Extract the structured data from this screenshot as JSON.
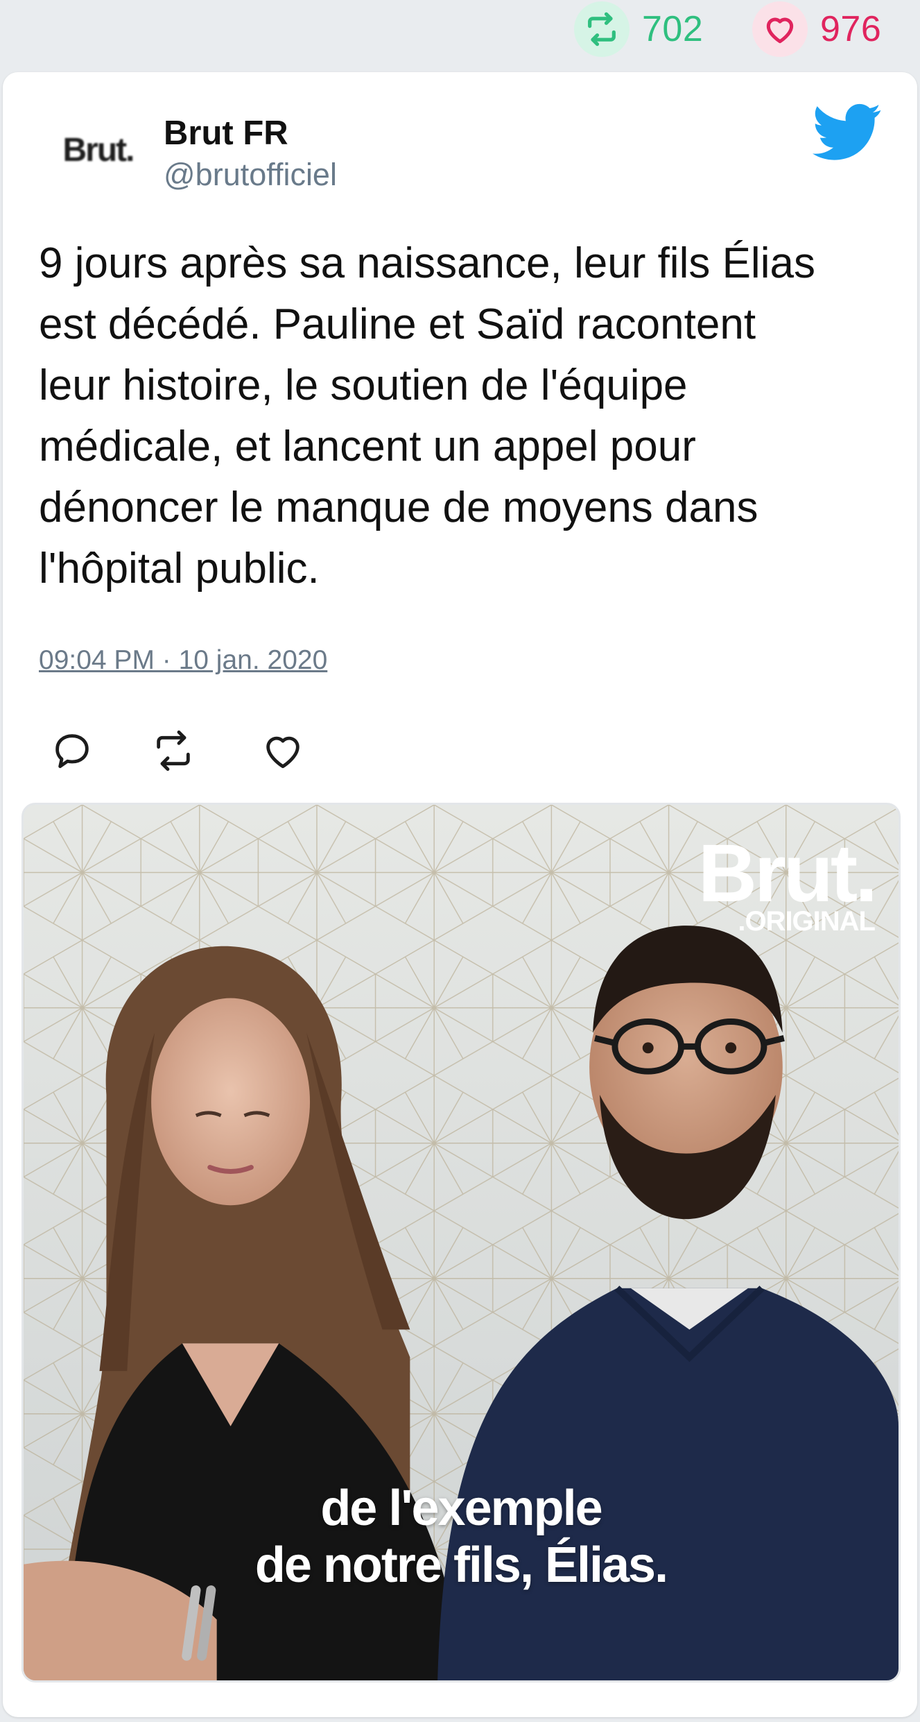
{
  "stats": {
    "retweets": "702",
    "likes": "976"
  },
  "tweet": {
    "avatar_text": "Brut.",
    "author_name": "Brut FR",
    "author_handle": "@brutofficiel",
    "text": "9 jours après sa naissance, leur fils Élias\nest décédé. Pauline et Saïd racontent\nleur histoire, le soutien de l'équipe\nmédicale, et lancent un appel pour\ndénoncer le manque de moyens dans\nl'hôpital public.",
    "timestamp": "09:04 PM · 10 jan. 2020"
  },
  "media": {
    "logo_word": "Brut.",
    "logo_sub": ".ORIGINAL",
    "caption": "de l'exemple\nde notre fils, Élias."
  },
  "colors": {
    "retweet_green": "#2fbf7f",
    "like_red": "#e0245e",
    "twitter_blue": "#1da1f2",
    "muted_text": "#697a8a"
  },
  "icons": {
    "retweet_stat": "retweet-icon",
    "like_stat": "heart-icon",
    "brand": "twitter-bird-icon",
    "reply_action": "reply-icon",
    "retweet_action": "retweet-icon",
    "like_action": "heart-icon"
  }
}
